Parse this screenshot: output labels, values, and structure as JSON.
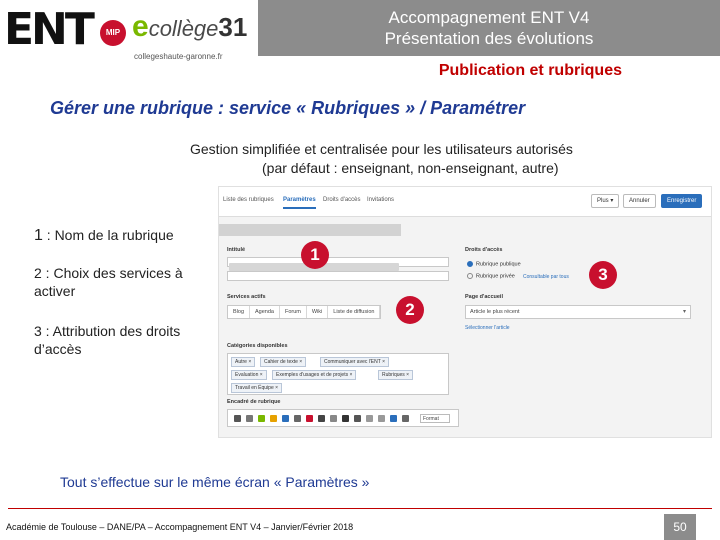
{
  "header": {
    "logo_ent": "ENT",
    "logo_mip": "MIP",
    "logo_college_e": "e",
    "logo_college_text": "collège",
    "logo_college_num": "31",
    "logo_url": "collegeshaute-garonne.fr",
    "title_line1": "Accompagnement ENT V4",
    "title_line2": "Présentation des évolutions",
    "subtitle": "Publication et rubriques"
  },
  "main": {
    "heading": "Gérer une rubrique  : service « Rubriques » / Paramétrer",
    "intro_prefix": "Gestion ",
    "intro_emph": "simplifiée et centralisée",
    "intro_suffix": " pour les utilisateurs autorisés",
    "intro_line2": "(par défaut : enseignant, non-enseignant, autre)",
    "label1_num": "1",
    "label1_text": " : Nom de la rubrique",
    "label2": "2 : Choix des services à activer",
    "label3": "3 : Attribution des droits d’accès",
    "conclusion": "Tout s’effectue sur le même écran « Paramètres »"
  },
  "screenshot": {
    "tabs": [
      "Liste des rubriques",
      "Paramètres",
      "Droits d'accès",
      "Invitations"
    ],
    "active_tab": "Paramètres",
    "btn_plus": "Plus ▾",
    "btn_cancel": "Annuler",
    "btn_save": "Enregistrer",
    "field_title": "Intitulé",
    "field_services": "Services actifs",
    "services": [
      "Blog",
      "Agenda",
      "Forum",
      "Wiki",
      "Liste de diffusion"
    ],
    "field_categories": "Catégories disponibles",
    "categories_row1": [
      "Autre ×",
      "Cahier de texte ×",
      "Communiquer avec l'ENT ×"
    ],
    "categories_row2": [
      "Evaluation ×",
      "Exemples d'usages et de projets ×",
      "Rubriques ×"
    ],
    "categories_row3": [
      "Travail en Équipe ×"
    ],
    "field_header": "Encadré de rubrique",
    "editor_select": "Format",
    "field_rights": "Droits d'accès",
    "radio_public": "Rubrique publique",
    "radio_private": "Rubrique privée",
    "link_public": "Consultable par tous",
    "field_home": "Page d'accueil",
    "home_select": "Article le plus récent",
    "link_select_article": "Sélectionner l'article"
  },
  "badges": {
    "b1": "1",
    "b2": "2",
    "b3": "3"
  },
  "footer": {
    "text": "Académie de Toulouse – DANE/PA – Accompagnement ENT V4 – Janvier/Février 2018",
    "page": "50"
  },
  "colors": {
    "accent_red": "#c8102e",
    "heading_blue": "#1f3a93",
    "header_gray": "#8c8c8c",
    "link_blue": "#2a6ebb"
  }
}
